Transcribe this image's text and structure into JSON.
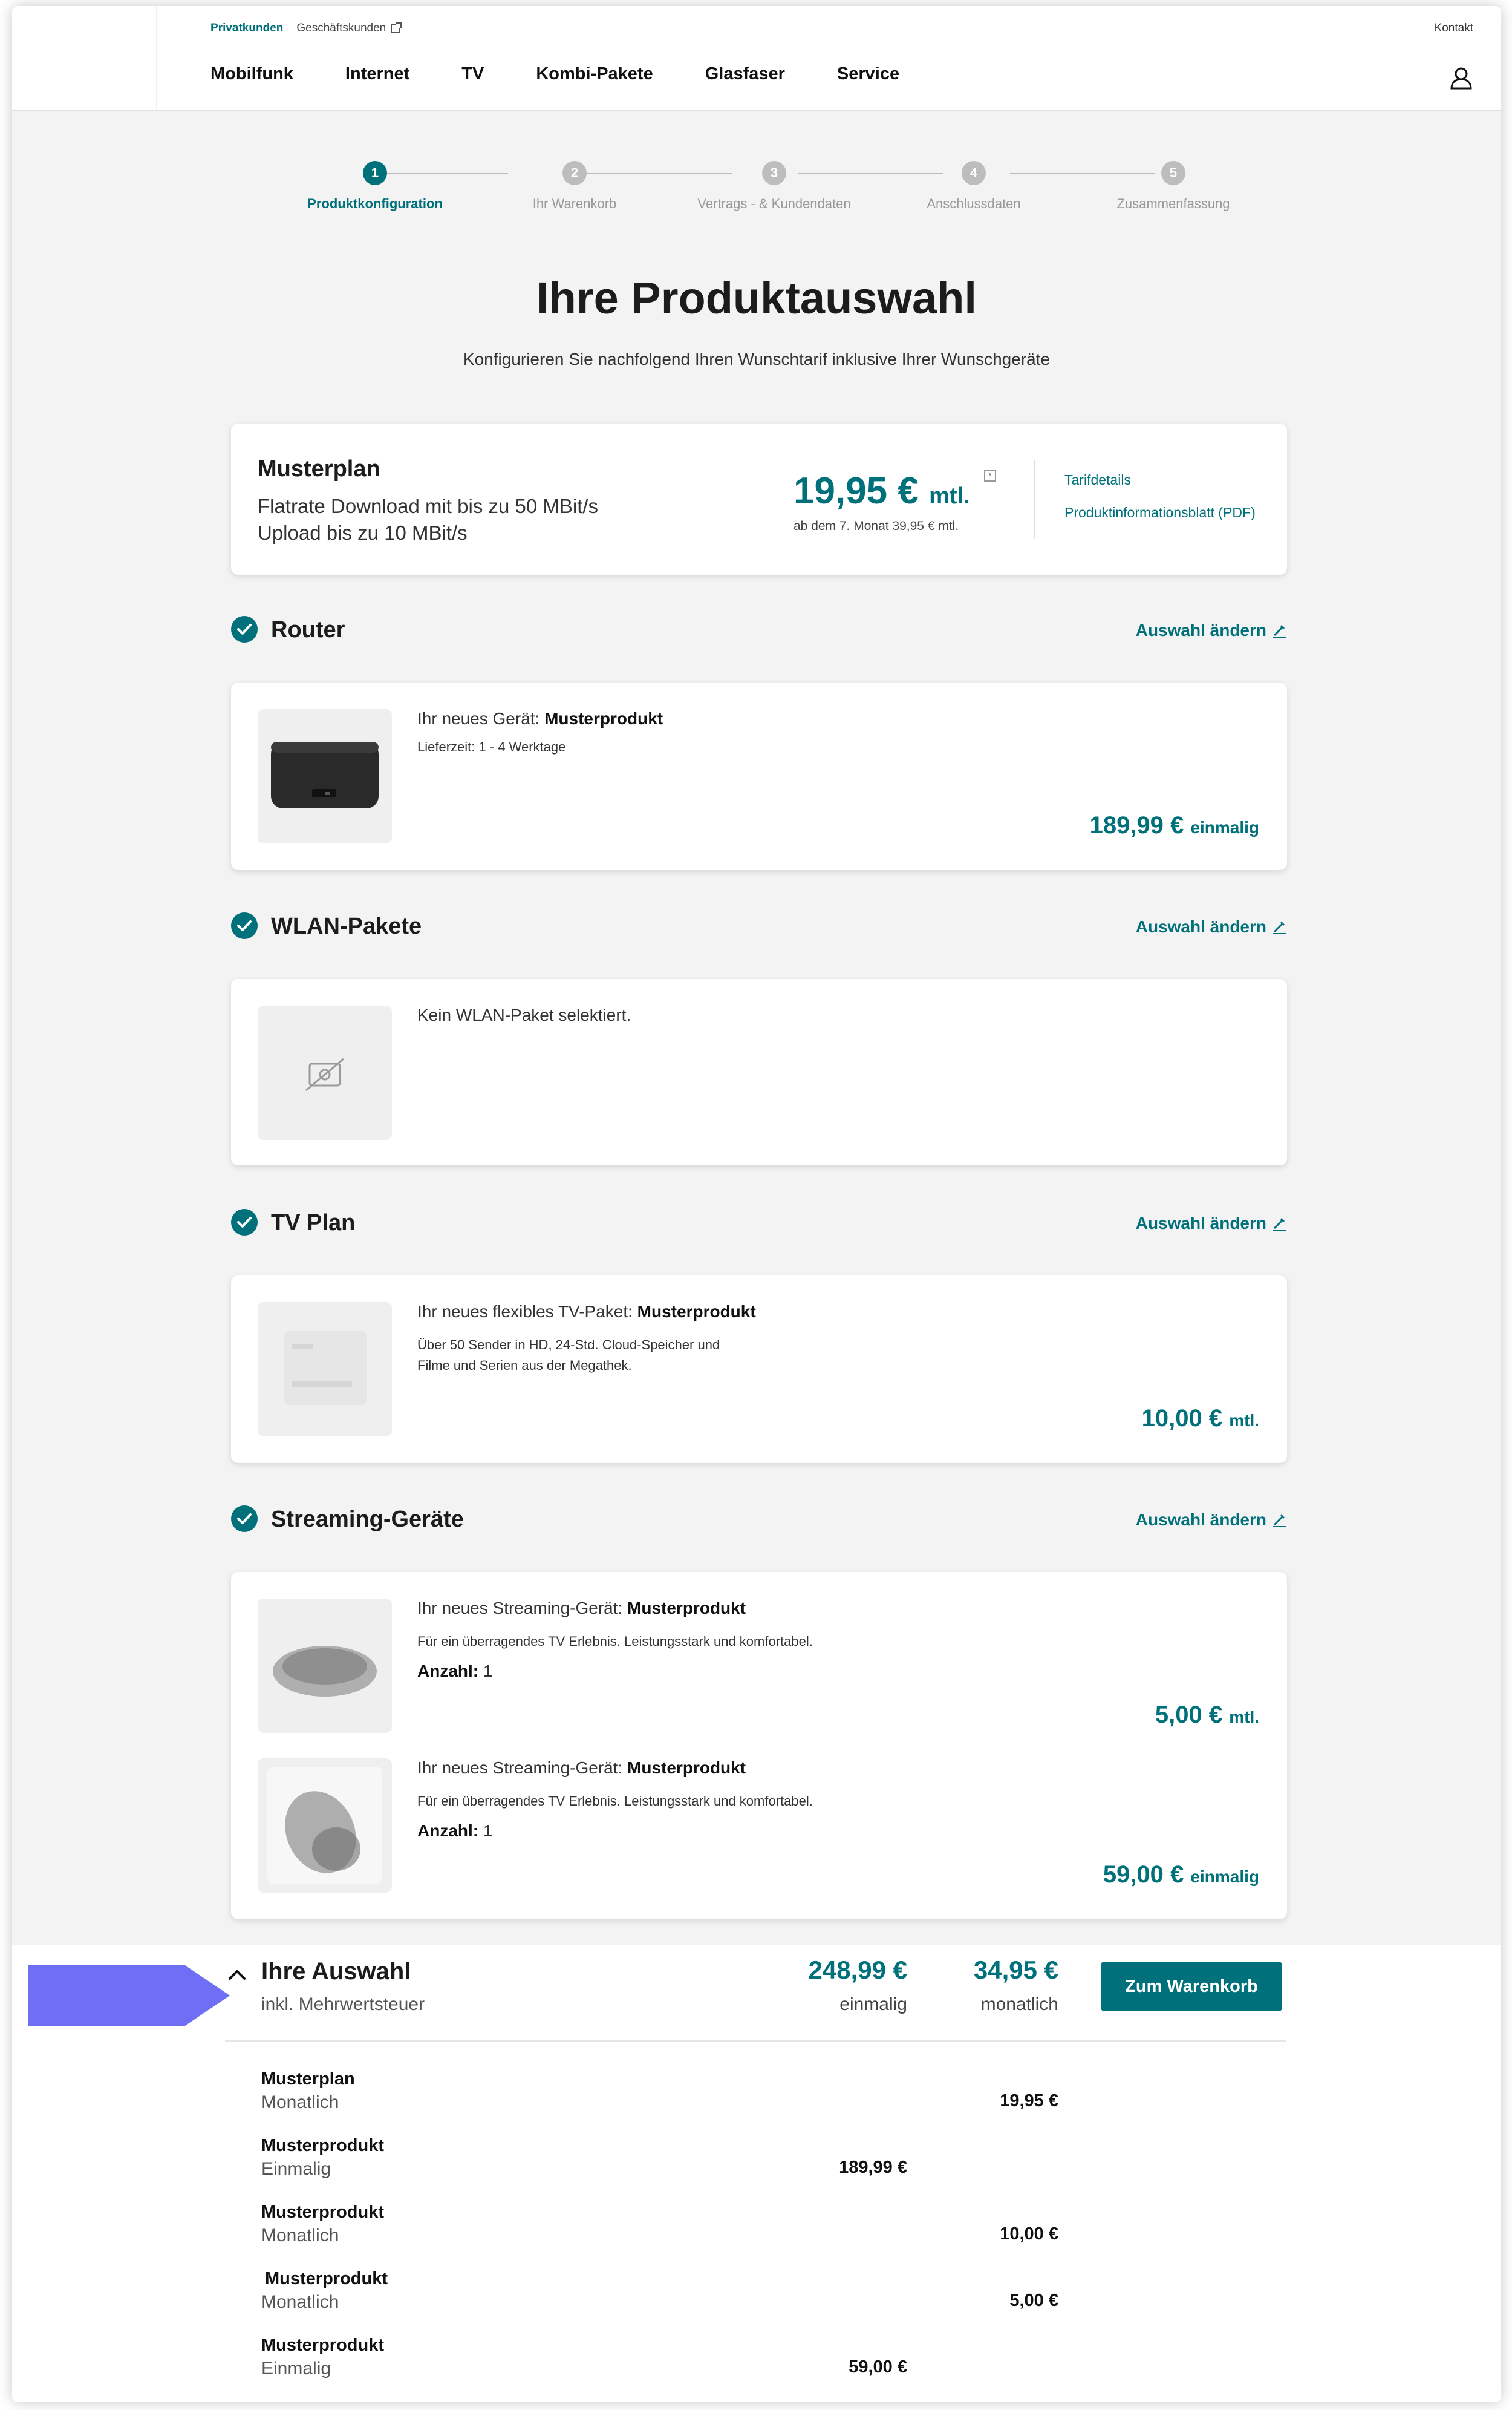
{
  "header": {
    "segment_active": "Privatkunden",
    "segment_other": "Geschäftskunden",
    "contact": "Kontakt",
    "nav": [
      "Mobilfunk",
      "Internet",
      "TV",
      "Kombi-Pakete",
      "Glasfaser",
      "Service"
    ]
  },
  "stepper": {
    "steps": [
      {
        "num": "1",
        "label": "Produktkonfiguration"
      },
      {
        "num": "2",
        "label": "Ihr Warenkorb"
      },
      {
        "num": "3",
        "label": "Vertrags - & Kundendaten"
      },
      {
        "num": "4",
        "label": "Anschlussdaten"
      },
      {
        "num": "5",
        "label": "Zusammenfassung"
      }
    ],
    "active_step": 1
  },
  "page": {
    "title": "Ihre Produktauswahl",
    "subtitle": "Konfigurieren Sie nachfolgend Ihren Wunschtarif inklusive Ihrer Wunschgeräte"
  },
  "plan": {
    "name": "Musterplan",
    "line1": "Flatrate Download mit bis zu 50 MBit/s",
    "line2": "Upload bis zu 10 MBit/s",
    "price": "19,95 €",
    "unit": "mtl.",
    "info_marker": "*",
    "after_note": "ab dem 7. Monat 39,95 € mtl.",
    "link_tarif": "Tarifdetails",
    "link_pib": "Produktinformationsblatt (PDF)"
  },
  "change_label": "Auswahl ändern",
  "sections": {
    "router": {
      "title": "Router",
      "prefix": "Ihr neues Gerät: ",
      "product": "Musterprodukt",
      "delivery": "Lieferzeit: 1 - 4 Werktage",
      "price": "189,99 €",
      "unit": "einmalig"
    },
    "wlan": {
      "title": "WLAN-Pakete",
      "empty_text": "Kein WLAN-Paket selektiert."
    },
    "tv": {
      "title": "TV Plan",
      "prefix": "Ihr neues flexibles TV-Paket: ",
      "product": "Musterprodukt",
      "desc1": "Über 50 Sender in HD, 24-Std. Cloud-Speicher und",
      "desc2": "Filme und Serien aus der Megathek.",
      "price": "10,00 €",
      "unit": "mtl."
    },
    "streaming": {
      "title": "Streaming-Geräte",
      "items": [
        {
          "prefix": "Ihr neues Streaming-Gerät: ",
          "product": "Musterprodukt",
          "desc": "Für ein überragendes TV Erlebnis. Leistungsstark und komfortabel.",
          "qty_label": "Anzahl:",
          "qty": " 1",
          "price": "5,00 €",
          "unit": "mtl."
        },
        {
          "prefix": "Ihr neues Streaming-Gerät: ",
          "product": "Musterprodukt",
          "desc": "Für ein überragendes TV Erlebnis. Leistungsstark und komfortabel.",
          "qty_label": "Anzahl:",
          "qty": " 1",
          "price": "59,00 €",
          "unit": "einmalig"
        }
      ]
    }
  },
  "summary": {
    "title": "Ihre Auswahl",
    "subtitle": "inkl. Mehrwertsteuer",
    "total_once": "248,99 €",
    "total_once_label": "einmalig",
    "total_monthly": "34,95 €",
    "total_monthly_label": "monatlich",
    "cart_button": "Zum Warenkorb",
    "rows": [
      {
        "name": "Musterplan",
        "type": "Monatlich",
        "once": "",
        "monthly": "19,95 €"
      },
      {
        "name": "Musterprodukt",
        "type": "Einmalig",
        "once": "189,99 €",
        "monthly": ""
      },
      {
        "name": "Musterprodukt",
        "type": "Monatlich",
        "once": "",
        "monthly": "10,00 €"
      },
      {
        "name": "Musterprodukt",
        "type": "Monatlich",
        "once": "",
        "monthly": "5,00 €"
      },
      {
        "name": "Musterprodukt",
        "type": "Einmalig",
        "once": "59,00 €",
        "monthly": ""
      }
    ]
  },
  "colors": {
    "accent": "#00707a",
    "indicator_arrow": "#6f6ff5",
    "page_bg": "#f3f3f3"
  }
}
